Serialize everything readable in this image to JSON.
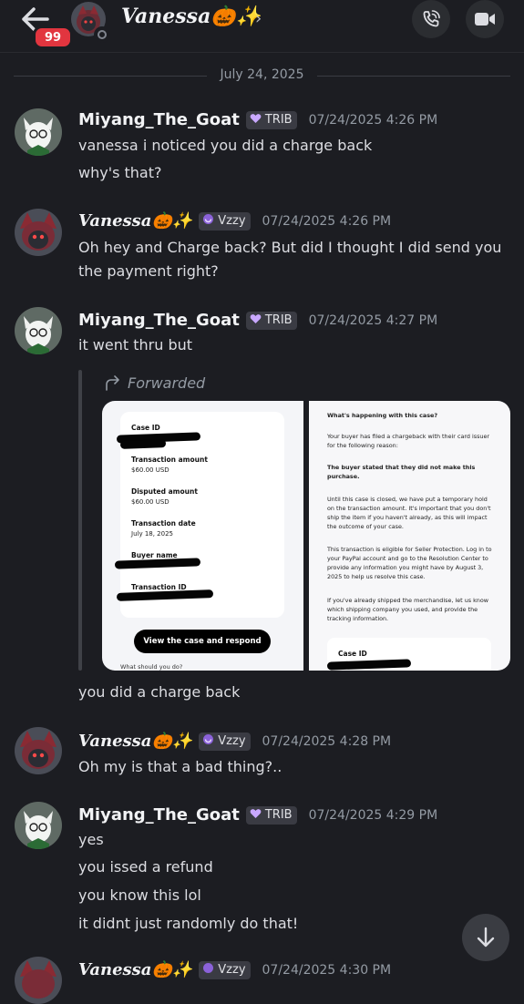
{
  "header": {
    "unread_count": "99",
    "channel_name": "Vanessa🎃✨",
    "chevron": "›",
    "icons": [
      "back-arrow-icon",
      "phone-call-icon",
      "video-camera-icon"
    ]
  },
  "date_divider": "July 24, 2025",
  "messages": [
    {
      "author": "Miyang_The_Goat",
      "tag": "TRIB",
      "timestamp": "07/24/2025 4:26 PM",
      "lines": [
        "vanessa i noticed you did a charge back",
        "why's that?"
      ]
    },
    {
      "author": "Vanessa🎃✨",
      "tag": "Vzzy",
      "timestamp": "07/24/2025 4:26 PM",
      "lines": [
        "Oh hey and Charge back? But did I thought I did send you",
        "the payment right?"
      ]
    },
    {
      "author": "Miyang_The_Goat",
      "tag": "TRIB",
      "timestamp": "07/24/2025 4:27 PM",
      "lines": [
        "it went thru but"
      ],
      "forward": {
        "label": "Forwarded",
        "left_image": {
          "case_id_label": "Case ID",
          "transaction_amount_label": "Transaction amount",
          "transaction_amount": "$60.00 USD",
          "disputed_amount_label": "Disputed amount",
          "disputed_amount": "$60.00 USD",
          "transaction_date_label": "Transaction date",
          "transaction_date": "July 18, 2025",
          "buyer_name_label": "Buyer name",
          "transaction_id_label": "Transaction ID",
          "button": "View the case and respond",
          "cut_text": "What should you do?"
        },
        "right_image": {
          "heading": "What's happening with this case?",
          "p1": "Your buyer has filed a chargeback with their card issuer for the following reason:",
          "p2": "The buyer stated that they did not make this purchase.",
          "p3": "Until this case is closed, we have put a temporary hold on the transaction amount. It's important that you don't ship the item if you haven't already, as this will impact the outcome of your case.",
          "p4": "This transaction is eligible for Seller Protection. Log in to your PayPal account and go to the Resolution Center to provide any information you might have by August 3, 2025 to help us resolve this case.",
          "p5": "If you've already shipped the merchandise, let us know which shipping company you used, and provide the tracking information.",
          "case_id_label": "Case ID"
        }
      },
      "after_lines": [
        "you did a charge back"
      ]
    },
    {
      "author": "Vanessa🎃✨",
      "tag": "Vzzy",
      "timestamp": "07/24/2025 4:28 PM",
      "lines": [
        "Oh my is that a bad thing?.."
      ]
    },
    {
      "author": "Miyang_The_Goat",
      "tag": "TRIB",
      "timestamp": "07/24/2025 4:29 PM",
      "lines": [
        "yes",
        "you issed a refund",
        "you know this lol",
        "it didnt just randomly do that!"
      ]
    },
    {
      "author": "Vanessa🎃✨",
      "tag": "Vzzy",
      "timestamp": "07/24/2025 4:30 PM",
      "lines": []
    }
  ],
  "colors": {
    "background": "#1c1d22",
    "badge": "#e2353f",
    "tag_background": "#3a3b43",
    "tag_heart": "#c9a8ff"
  }
}
